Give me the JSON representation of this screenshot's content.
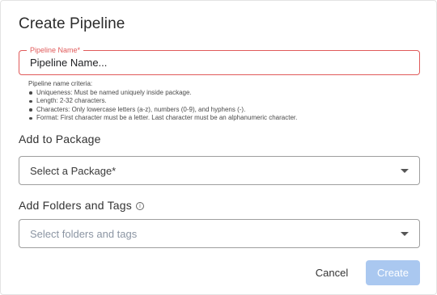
{
  "dialog": {
    "title": "Create Pipeline"
  },
  "pipeline_name": {
    "label": "Pipeline Name*",
    "placeholder": "Pipeline Name...",
    "value": ""
  },
  "criteria": {
    "heading": "Pipeline name criteria:",
    "items": [
      "Uniqueness: Must be named uniquely inside package.",
      "Length: 2-32 characters.",
      "Characters: Only lowercase letters (a-z), numbers (0-9), and hyphens (-).",
      "Format: First character must be a letter. Last character must be an alphanumeric character."
    ]
  },
  "package": {
    "section_label": "Add to Package",
    "placeholder": "Select a Package*"
  },
  "folders_tags": {
    "section_label": "Add Folders and Tags",
    "info_icon": "info-icon",
    "placeholder": "Select folders and tags"
  },
  "actions": {
    "cancel_label": "Cancel",
    "create_label": "Create"
  },
  "colors": {
    "error_red": "#e05a5a",
    "create_disabled_blue": "#aac8f0"
  }
}
